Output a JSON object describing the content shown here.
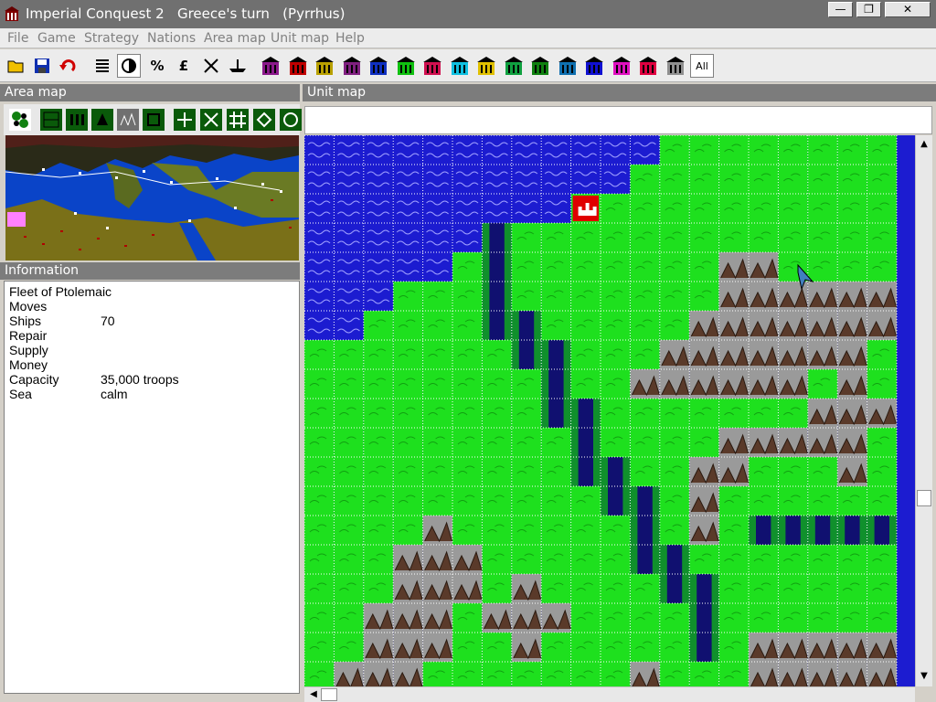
{
  "window": {
    "title": "Imperial Conquest 2   Greece's turn   (Pyrrhus)",
    "minimize_label": "—",
    "maximize_label": "❐",
    "close_label": "✕"
  },
  "menu": [
    "File",
    "Game",
    "Strategy",
    "Nations",
    "Area map",
    "Unit map",
    "Help"
  ],
  "toolbar": {
    "buttons": [
      {
        "name": "open-icon",
        "glyph": ""
      },
      {
        "name": "save-icon",
        "glyph": ""
      },
      {
        "name": "undo-icon",
        "glyph": ""
      },
      {
        "name": "list-icon",
        "glyph": ""
      },
      {
        "name": "contrast-icon",
        "glyph": ""
      },
      {
        "name": "percent-button",
        "glyph": "%"
      },
      {
        "name": "pound-button",
        "glyph": "£"
      },
      {
        "name": "battle-icon",
        "glyph": ""
      },
      {
        "name": "ship-icon",
        "glyph": ""
      }
    ],
    "nation_colors": [
      "#8b1a8b",
      "#c00000",
      "#b8a000",
      "#802080",
      "#1030c0",
      "#10c010",
      "#d01050",
      "#10c0e0",
      "#e0c000",
      "#10a040",
      "#108010",
      "#1070b0",
      "#1010d0",
      "#e010c0",
      "#e00040",
      "#909090"
    ],
    "all_label": "All"
  },
  "area_map": {
    "title": "Area map",
    "tools": [
      "nation-view-icon",
      "terrain-grid-icon",
      "city-grid-icon",
      "unit-grid-icon",
      "forest-grid-icon",
      "resource-grid-icon",
      "plus-icon",
      "cross-icon",
      "hash-icon",
      "diamond-icon",
      "circle-icon"
    ]
  },
  "information": {
    "title": "Information",
    "unit_name": "Fleet of Ptolemaic",
    "rows": [
      {
        "label": "Moves",
        "value": ""
      },
      {
        "label": "Ships",
        "value": "70"
      },
      {
        "label": "Repair",
        "value": ""
      },
      {
        "label": "Supply",
        "value": ""
      },
      {
        "label": "Money",
        "value": ""
      },
      {
        "label": "Capacity",
        "value": "35,000 troops"
      },
      {
        "label": "Sea",
        "value": "calm"
      }
    ]
  },
  "unit_map": {
    "title": "Unit map",
    "colors": {
      "sea": "#1c1cd0",
      "grass": "#1ee01e",
      "mountain": "#9a9a9a",
      "river_bank": "#10902c",
      "river": "#101070",
      "city_bg": "#e00000"
    },
    "grid": [
      "SSSSSSSSSSSSGGGGGGGG",
      "SSSSSSSSSSSGGGGGGGGG",
      "SSSSSSSSSCGGGGGGGGGG",
      "SSSSSSRGGGGGGGGGGGGG",
      "SSSSSGRGGGGGGGMMGGGG",
      "SSSGGGRGGGGGGGMMMMMM",
      "SSGGGGRRGGGGGMMMMMMM",
      "GGGGGGGRRGGGMMMMMMMG",
      "GGGGGGGGRGGMMMMMMGMG",
      "GGGGGGGGRRGGGGGGGMMM",
      "GGGGGGGGGRGGGGMMMMMG",
      "GGGGGGGGGRRGGMMGGGMG",
      "GGGGGGGGGGRRGMGGGGGG",
      "GGGGMGGGGGGRGMGRRRRR",
      "GGGMMMGGGGGRRGGGGGGG",
      "GGGMMMGMGGGGRRGGGGGG",
      "GGMMMGMMMGGGGRGGGGGG",
      "GGMMMGGMGGGGGRGMMMMM",
      "GMMMGGGGGGGMGGGMMMMM"
    ]
  }
}
